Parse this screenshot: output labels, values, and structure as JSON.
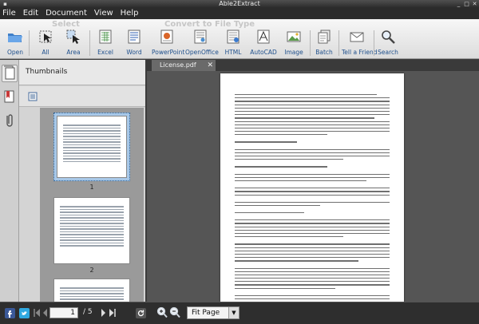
{
  "window": {
    "title": "Able2Extract"
  },
  "menu": [
    "File",
    "Edit",
    "Document",
    "View",
    "Help"
  ],
  "toolbar": {
    "select_label": "Select",
    "convert_label": "Convert to File Type",
    "buttons": {
      "open": "Open",
      "all": "All",
      "area": "Area",
      "excel": "Excel",
      "word": "Word",
      "powerpoint": "PowerPoint",
      "openoffice": "OpenOffice",
      "html": "HTML",
      "autocad": "AutoCAD",
      "image": "Image",
      "batch": "Batch",
      "tell_friend": "Tell a Friend",
      "search": "Search"
    }
  },
  "sidebar": {
    "title": "Thumbnails",
    "thumbnails": [
      {
        "number": "1"
      },
      {
        "number": "2"
      }
    ]
  },
  "document": {
    "tab_title": "License.pdf",
    "tab_close": "✕"
  },
  "status": {
    "current_page": "1",
    "total_pages": "/ 5",
    "zoom": "Fit Page"
  },
  "colors": {
    "accent_label": "#1e4f8c",
    "selection": "#a8c8e8"
  }
}
